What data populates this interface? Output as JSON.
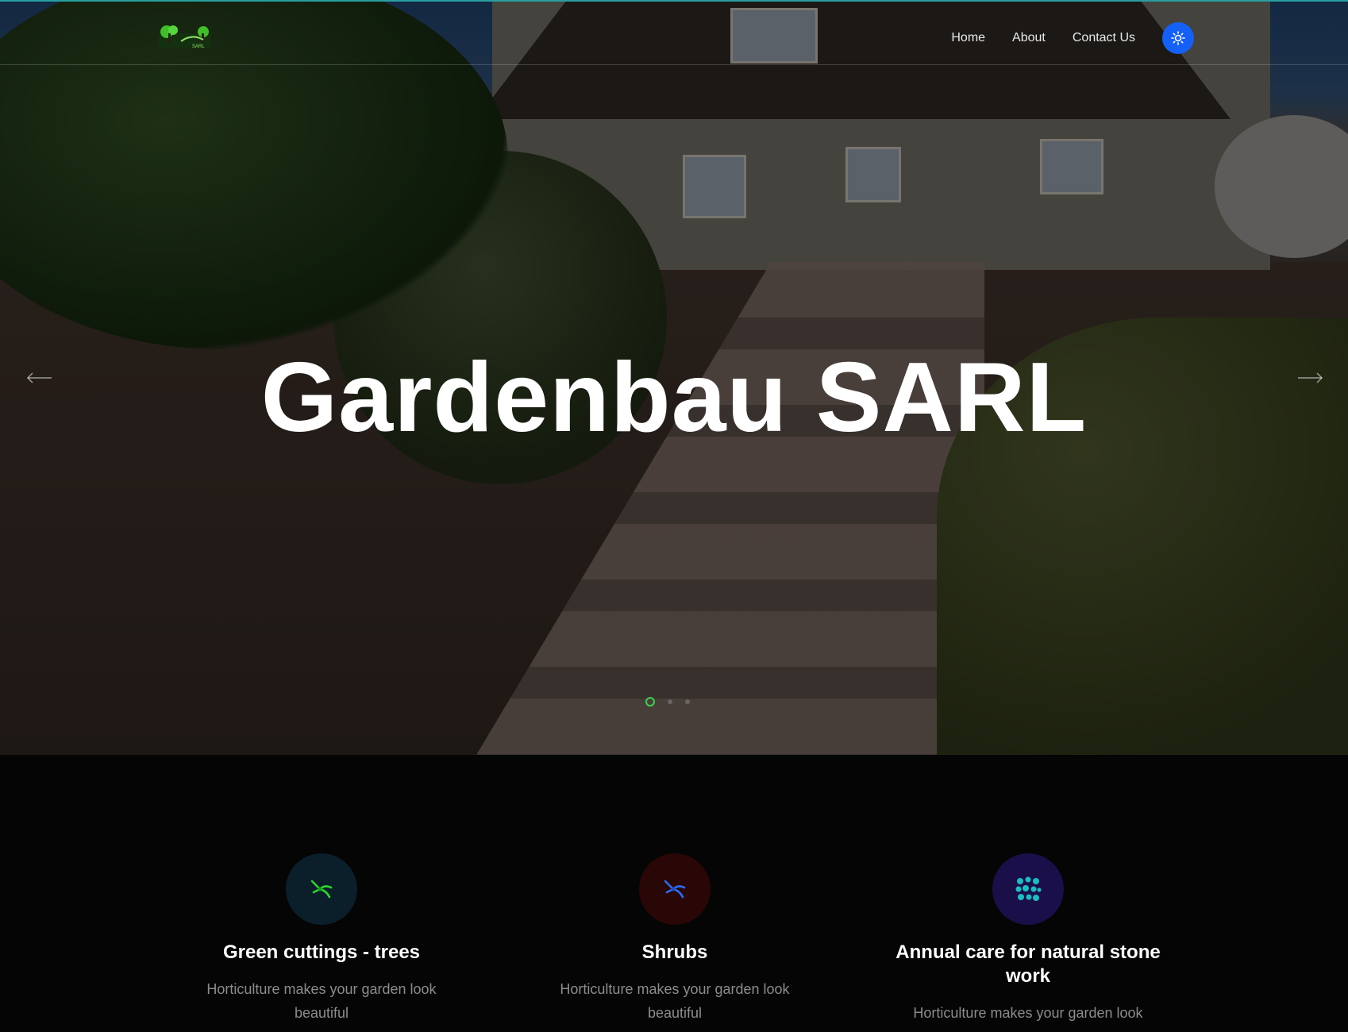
{
  "brand": {
    "logo_text": "SARL",
    "logo_icon": "trees-logo-icon"
  },
  "nav": {
    "items": [
      {
        "label": "Home"
      },
      {
        "label": "About"
      },
      {
        "label": "Contact Us"
      }
    ],
    "theme_toggle_icon": "sun-icon"
  },
  "hero": {
    "title": "Gardenbau SARL",
    "prev_icon": "arrow-left-icon",
    "next_icon": "arrow-right-icon",
    "slide_count": 3,
    "active_slide": 1
  },
  "services": [
    {
      "title": "Green cuttings - trees",
      "description": "Horticulture makes your garden look beautiful",
      "icon": "pruning-shears-icon",
      "icon_color": "#2bd62f",
      "bg_color": "#0b1f2b"
    },
    {
      "title": "Shrubs",
      "description": "Horticulture makes your garden look beautiful",
      "icon": "pruning-shears-icon",
      "icon_color": "#2a6cf2",
      "bg_color": "#2a0707"
    },
    {
      "title": "Annual care for natural stone work",
      "description": "Horticulture makes your garden look",
      "icon": "stone-pattern-icon",
      "icon_color": "#1dbdc4",
      "bg_color": "#1b0f4a"
    }
  ],
  "colors": {
    "accent": "#1560f6",
    "topline": "#2a9fa0",
    "active_dot": "#3bd14a"
  }
}
